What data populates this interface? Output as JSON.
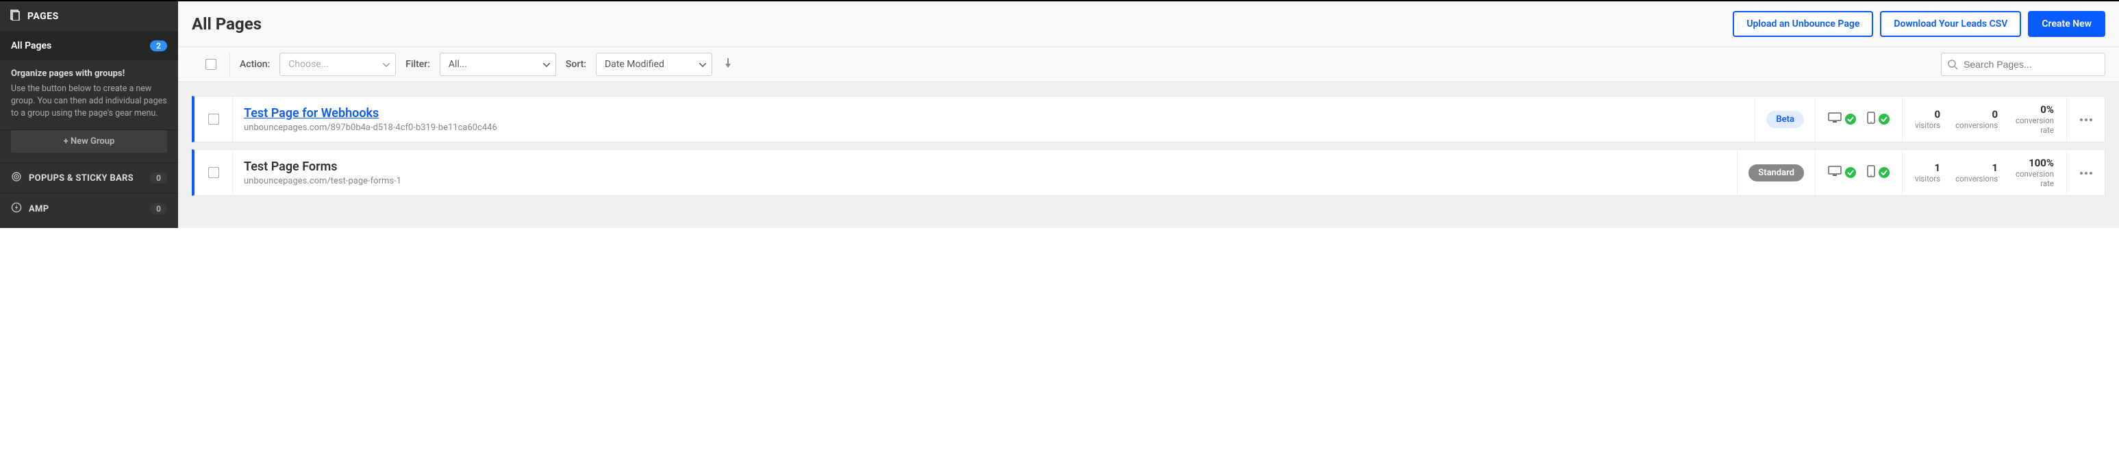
{
  "sidebar": {
    "header": "PAGES",
    "all_pages": {
      "label": "All Pages",
      "count": "2"
    },
    "groups": {
      "title": "Organize pages with groups!",
      "desc": "Use the button below to create a new group. You can then add individual pages to a group using the page's gear menu.",
      "button": "+ New Group"
    },
    "nav": [
      {
        "label": "POPUPS & STICKY BARS",
        "count": "0"
      },
      {
        "label": "AMP",
        "count": "0"
      }
    ]
  },
  "header": {
    "title": "All Pages",
    "upload": "Upload an Unbounce Page",
    "download": "Download Your Leads CSV",
    "create": "Create New"
  },
  "filters": {
    "action_label": "Action:",
    "action_placeholder": "Choose...",
    "filter_label": "Filter:",
    "filter_value": "All...",
    "sort_label": "Sort:",
    "sort_value": "Date Modified",
    "search_placeholder": "Search Pages..."
  },
  "stat_labels": {
    "visitors": "visitors",
    "conversions": "conversions",
    "rate": "conversion rate"
  },
  "pages": [
    {
      "title": "Test Page for Webhooks",
      "url": "unbouncepages.com/897b0b4a-d518-4cf0-b319-be11ca60c446",
      "link": true,
      "tag": "Beta",
      "tag_class": "beta",
      "visitors": "0",
      "conversions": "0",
      "rate": "0%"
    },
    {
      "title": "Test Page Forms",
      "url": "unbouncepages.com/test-page-forms-1",
      "link": false,
      "tag": "Standard",
      "tag_class": "std",
      "visitors": "1",
      "conversions": "1",
      "rate": "100%"
    }
  ]
}
